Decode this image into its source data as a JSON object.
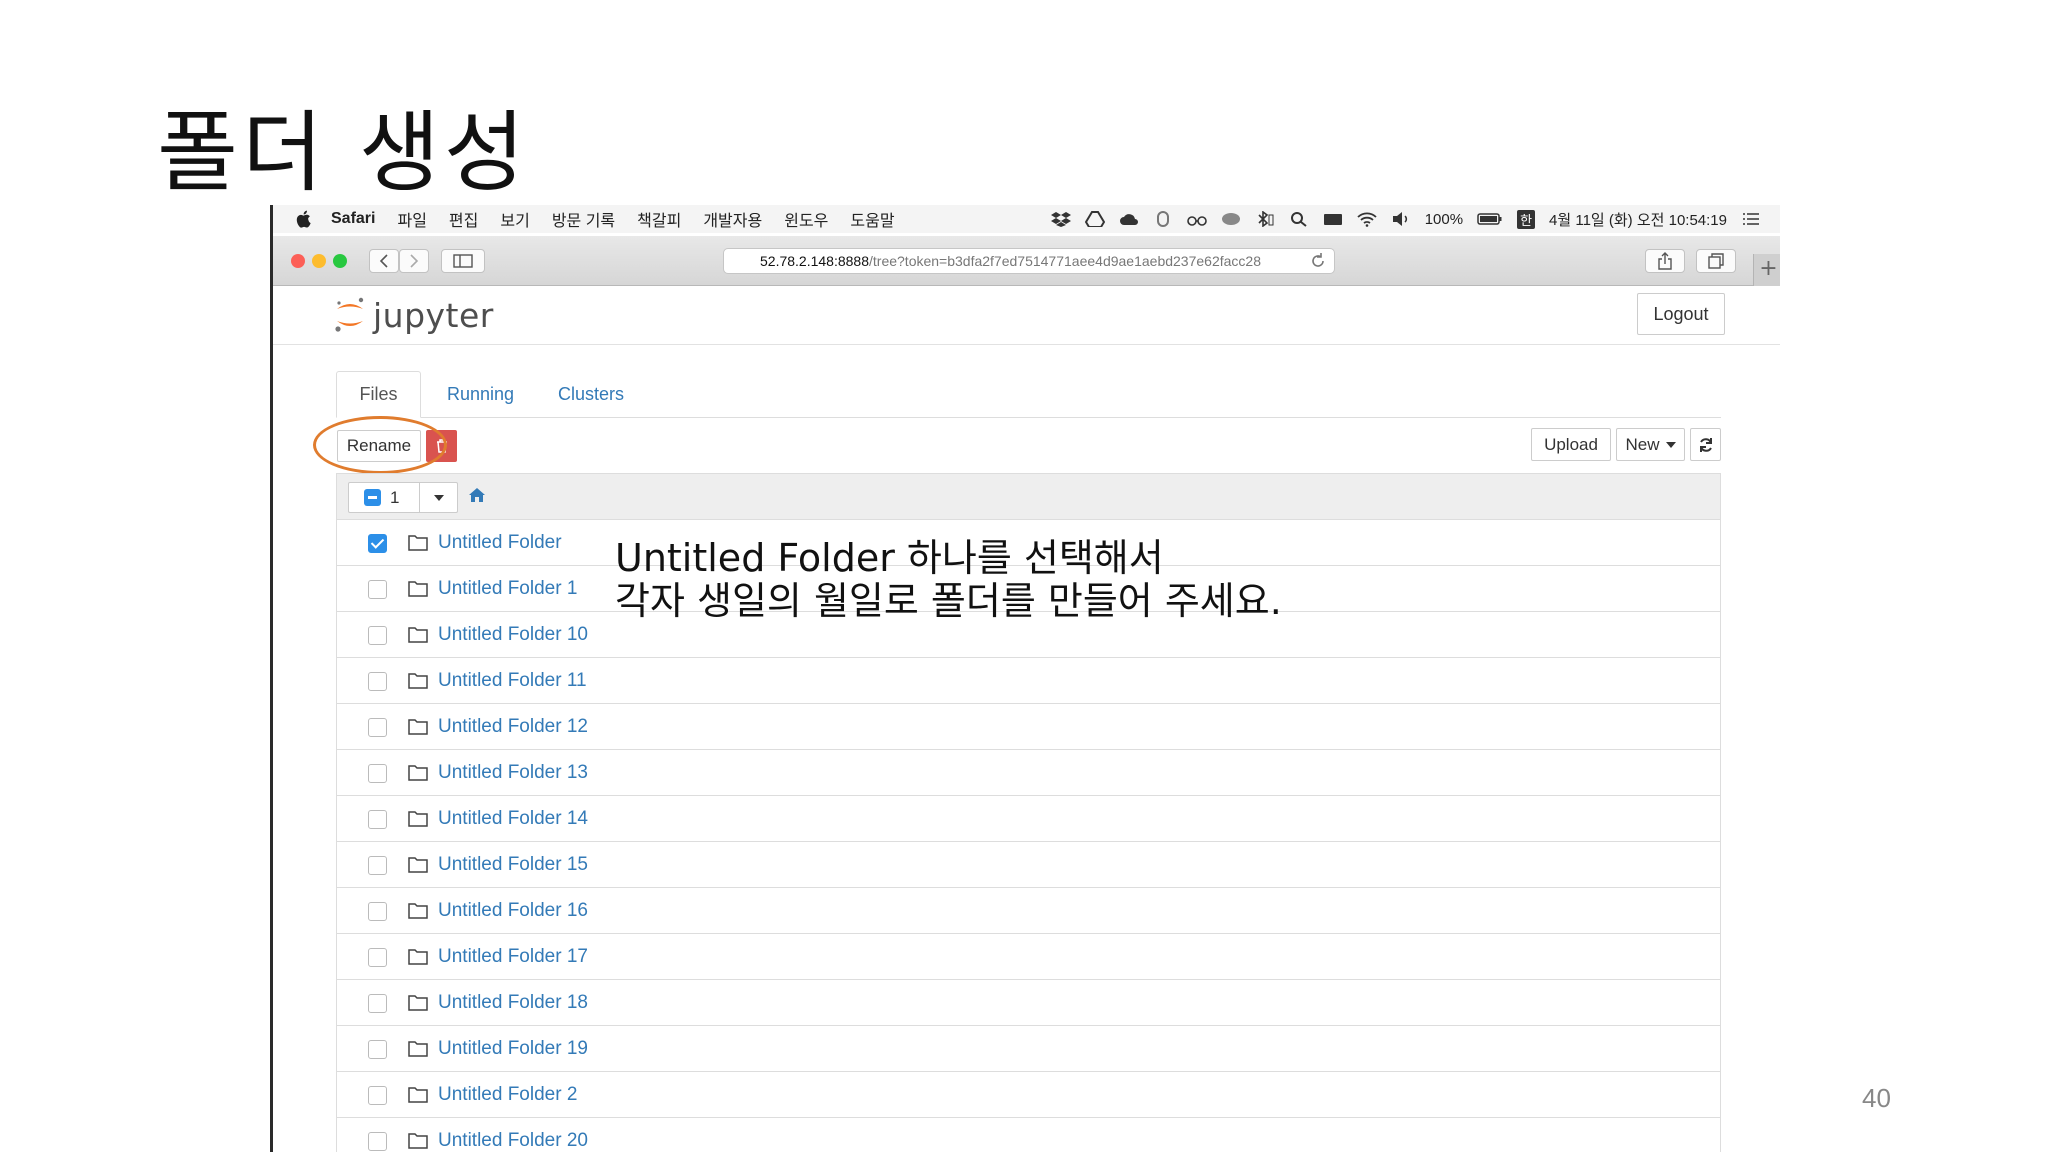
{
  "slide": {
    "title": "폴더 생성",
    "page_number": "40"
  },
  "menubar": {
    "app": "Safari",
    "items": [
      "파일",
      "편집",
      "보기",
      "방문 기록",
      "책갈피",
      "개발자용",
      "윈도우",
      "도움말"
    ],
    "battery": "100%",
    "ime": "한",
    "datetime": "4월 11일 (화) 오전 10:54:19"
  },
  "browser": {
    "url_host": "52.78.2.148:8888",
    "url_path": "/tree?token=b3dfa2f7ed7514771aee4d9ae1aebd237e62facc28"
  },
  "jupyter": {
    "logo_text": "jupyter",
    "logout_label": "Logout",
    "tabs": [
      {
        "label": "Files",
        "active": true
      },
      {
        "label": "Running",
        "active": false
      },
      {
        "label": "Clusters",
        "active": false
      }
    ],
    "actions": {
      "rename_label": "Rename",
      "upload_label": "Upload",
      "new_label": "New"
    },
    "selected_count": "1",
    "folders": [
      {
        "name": "Untitled Folder",
        "checked": true
      },
      {
        "name": "Untitled Folder 1",
        "checked": false
      },
      {
        "name": "Untitled Folder 10",
        "checked": false
      },
      {
        "name": "Untitled Folder 11",
        "checked": false
      },
      {
        "name": "Untitled Folder 12",
        "checked": false
      },
      {
        "name": "Untitled Folder 13",
        "checked": false
      },
      {
        "name": "Untitled Folder 14",
        "checked": false
      },
      {
        "name": "Untitled Folder 15",
        "checked": false
      },
      {
        "name": "Untitled Folder 16",
        "checked": false
      },
      {
        "name": "Untitled Folder 17",
        "checked": false
      },
      {
        "name": "Untitled Folder 18",
        "checked": false
      },
      {
        "name": "Untitled Folder 19",
        "checked": false
      },
      {
        "name": "Untitled Folder 2",
        "checked": false
      },
      {
        "name": "Untitled Folder 20",
        "checked": false
      }
    ]
  },
  "annotation": {
    "line1": "Untitled Folder 하나를 선택해서",
    "line2": "각자 생일의 월일로 폴더를 만들어 주세요."
  },
  "colors": {
    "link": "#337ab7",
    "delete": "#d9534f",
    "highlight_circle": "#e07c2e",
    "checkbox": "#2c8fe8"
  }
}
